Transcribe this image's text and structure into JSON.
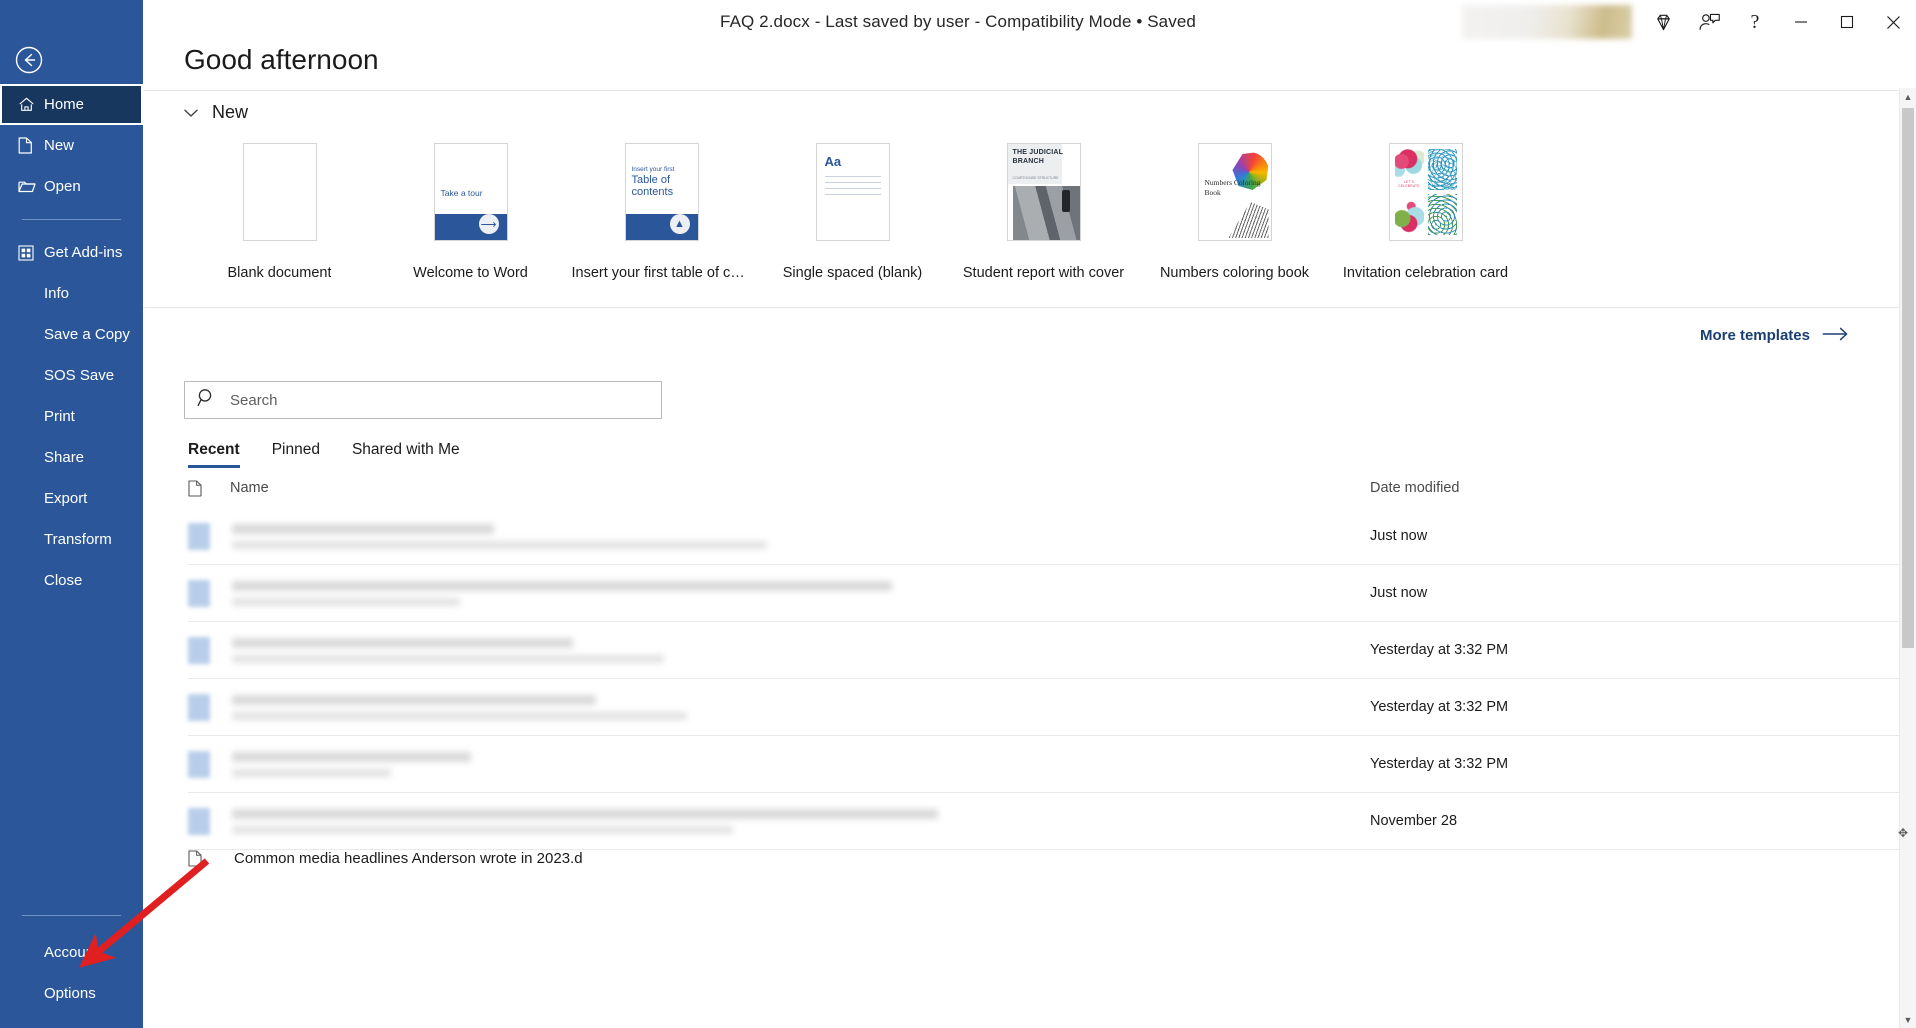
{
  "titlebar": {
    "document_title": "FAQ 2.docx  -  Last saved by user  -  Compatibility Mode • Saved",
    "diamond_icon": "diamond-icon",
    "reviewer_icon": "person-comment-icon",
    "help_label": "?",
    "minimize_label": "minimize-icon",
    "maximize_label": "maximize-icon",
    "close_label": "close-icon"
  },
  "sidebar": {
    "back_label": "back-arrow-icon",
    "items": [
      {
        "label": "Home",
        "icon": "home-icon",
        "selected": true
      },
      {
        "label": "New",
        "icon": "page-icon",
        "selected": false
      },
      {
        "label": "Open",
        "icon": "folder-icon",
        "selected": false
      }
    ],
    "items2": [
      {
        "label": "Get Add-ins",
        "icon": "grid-icon"
      },
      {
        "label": "Info",
        "icon": ""
      },
      {
        "label": "Save a Copy",
        "icon": ""
      },
      {
        "label": "SOS Save",
        "icon": ""
      },
      {
        "label": "Print",
        "icon": ""
      },
      {
        "label": "Share",
        "icon": ""
      },
      {
        "label": "Export",
        "icon": ""
      },
      {
        "label": "Transform",
        "icon": ""
      },
      {
        "label": "Close",
        "icon": ""
      }
    ],
    "bottom_items": [
      {
        "label": "Account"
      },
      {
        "label": "Options"
      }
    ],
    "background_color": "#2b579a",
    "selected_color": "#17375e"
  },
  "main": {
    "greeting": "Good afternoon",
    "new_section": {
      "title": "New",
      "chevron": "chevron-down-icon",
      "templates": [
        {
          "label": "Blank document",
          "kind": "blank"
        },
        {
          "label": "Welcome to Word",
          "kind": "tour",
          "thumb_text": "Take a tour"
        },
        {
          "label": "Insert your first table of con...",
          "kind": "toc",
          "thumb_small": "Insert your first",
          "thumb_big": "Table of contents"
        },
        {
          "label": "Single spaced (blank)",
          "kind": "aa",
          "thumb_text": "Aa"
        },
        {
          "label": "Student report with cover",
          "kind": "judicial",
          "thumb_title": "THE JUDICIAL BRANCH",
          "thumb_sub": "COURTHOUSE STRUCTURE"
        },
        {
          "label": "Numbers coloring book",
          "kind": "coloring",
          "thumb_text": "Numbers Coloring Book"
        },
        {
          "label": "Invitation celebration card",
          "kind": "invitation",
          "thumb_caption": "LET'S CELEBRATE"
        }
      ],
      "more_templates_label": "More templates",
      "more_templates_icon": "arrow-right-icon"
    },
    "search": {
      "placeholder": "Search",
      "value": "",
      "icon": "search-icon"
    },
    "tabs": [
      {
        "label": "Recent",
        "active": true
      },
      {
        "label": "Pinned",
        "active": false
      },
      {
        "label": "Shared with Me",
        "active": false
      }
    ],
    "file_list": {
      "columns": {
        "icon": "document-icon",
        "name": "Name",
        "date": "Date modified"
      },
      "rows": [
        {
          "name": "",
          "date": "Just now"
        },
        {
          "name": "",
          "date": "Just now"
        },
        {
          "name": "",
          "date": "Yesterday at 3:32 PM"
        },
        {
          "name": "",
          "date": "Yesterday at 3:32 PM"
        },
        {
          "name": "",
          "date": "Yesterday at 3:32 PM"
        },
        {
          "name": "",
          "date": "November 28"
        }
      ],
      "partial_row": {
        "name": "Common media headlines Anderson wrote in 2023.d",
        "date": ""
      }
    }
  },
  "scrollbar": {
    "up_icon": "chevron-up-icon",
    "down_icon": "chevron-down-icon"
  },
  "annotation": {
    "arrow_color": "#e02020",
    "points_to": "Options"
  }
}
